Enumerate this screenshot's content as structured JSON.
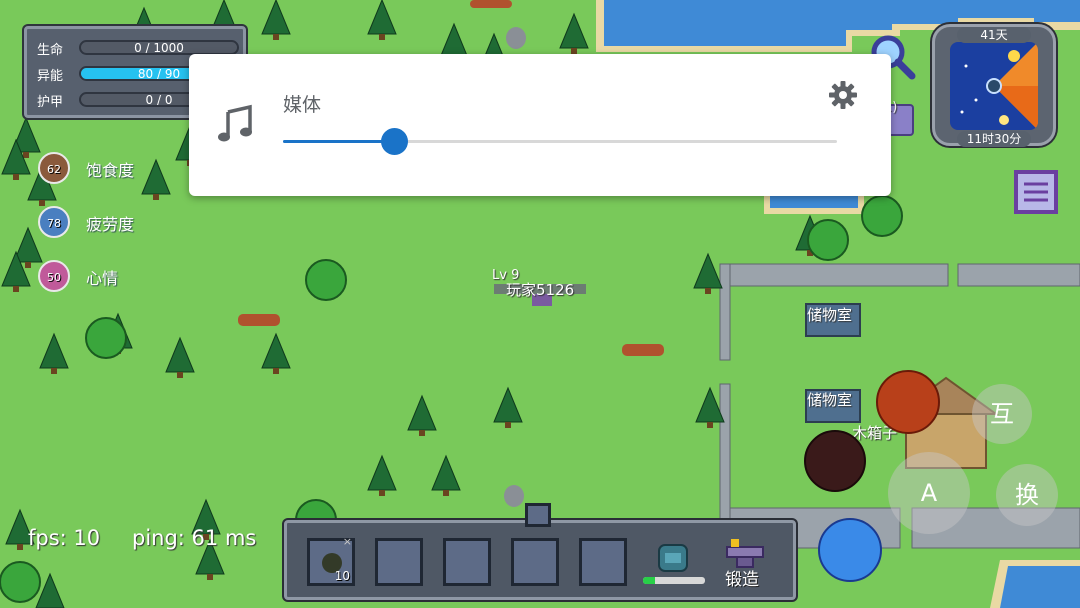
{
  "status": {
    "health": {
      "label": "生命",
      "text": "0 / 1000",
      "fraction": 0.0
    },
    "energy": {
      "label": "异能",
      "text": "80 / 90",
      "fraction": 0.89
    },
    "armor": {
      "label": "护甲",
      "text": "0 / 0",
      "fraction": 0.0
    }
  },
  "needs": [
    {
      "value": "62",
      "label": "饱食度",
      "color": "#8a5a3c"
    },
    {
      "value": "78",
      "label": "疲劳度",
      "color": "#4a7fc0"
    },
    {
      "value": "50",
      "label": "心情",
      "color": "#c05a9a"
    }
  ],
  "media": {
    "title": "媒体",
    "volume_fraction": 0.2,
    "accent": "#1a73c8",
    "icon": "music-note-icon",
    "settings_icon": "gear-icon"
  },
  "clock": {
    "day": "41天",
    "time": "11时30分"
  },
  "player": {
    "level": "Lv 9",
    "name": "玩家5126"
  },
  "map_labels": {
    "storage1": "储物室",
    "storage2": "储物室",
    "wood_box": "木箱子",
    "offscreen_count": "1)"
  },
  "hud": {
    "fps": "fps: 10",
    "ping": "ping: 61 ms"
  },
  "buttons": {
    "interact": "互",
    "attack": "A",
    "switch": "换"
  },
  "hotbar": {
    "slot1_count": "10",
    "slot1_remove": "×",
    "craft_label": "锻造",
    "durability_fraction": 0.2
  },
  "colors": {
    "grass": "#79c95a",
    "water": "#3f8ad6",
    "energy_bar": "#26c2f0",
    "panel": "#57606e"
  }
}
